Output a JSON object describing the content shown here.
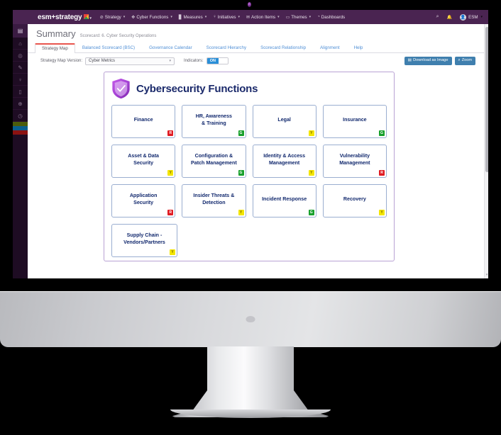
{
  "navbar": {
    "logo": "esm+strategy",
    "logo_caret": "▾",
    "items": [
      {
        "icon": "⊘",
        "label": "Strategy",
        "caret": "▾",
        "name": "strategy"
      },
      {
        "icon": "✥",
        "label": "Cyber Functions",
        "caret": "▾",
        "name": "cyber-functions"
      },
      {
        "icon": "▊",
        "label": "Measures",
        "caret": "▾",
        "name": "measures"
      },
      {
        "icon": "♀",
        "label": "Initiatives",
        "caret": "▾",
        "name": "initiatives"
      },
      {
        "icon": "✉",
        "label": "Action Items",
        "caret": "▾",
        "name": "action-items"
      },
      {
        "icon": "▭",
        "label": "Themes",
        "caret": "▾",
        "name": "themes"
      },
      {
        "icon": "◔",
        "label": "Dashboards",
        "caret": "",
        "name": "dashboards"
      }
    ],
    "search_icon": "⌕",
    "bell_icon": "🔔",
    "avatar_icon": "👤",
    "user": "ESM",
    "user_caret": "▾",
    "bg_color": "#4a2451"
  },
  "sidebar": {
    "top_icon": "▤",
    "icons": [
      "⌂",
      "◎",
      "✎",
      "♀",
      "▯",
      "⊕",
      "◷"
    ],
    "bars": [
      {
        "color": "#4c5c0b",
        "name": "bar-olive"
      },
      {
        "color": "#0a5f8f",
        "name": "bar-blue"
      },
      {
        "color": "#8c1212",
        "name": "bar-red"
      }
    ]
  },
  "page": {
    "title": "Summary",
    "breadcrumb": "Scorecard: 6. Cyber Security Operations"
  },
  "tabs": [
    {
      "label": "Strategy Map",
      "active": true
    },
    {
      "label": "Balanced Scorecard (BSC)",
      "active": false
    },
    {
      "label": "Governance Calendar",
      "active": false
    },
    {
      "label": "Scorecard Hierarchy",
      "active": false
    },
    {
      "label": "Scorecard Relationship",
      "active": false
    },
    {
      "label": "Alignment",
      "active": false
    },
    {
      "label": "Help",
      "active": false
    }
  ],
  "toolbar": {
    "version_label": "Strategy Map Version:",
    "version_value": "Cyber Metrics",
    "version_caret": "▾",
    "indicators_label": "Indicators:",
    "indicators_state": "ON",
    "download_icon": "▤",
    "download_label": "Download as Image",
    "zoom_icon": "⌕",
    "zoom_label": "Zoom"
  },
  "map": {
    "title": "Cybersecurity Functions",
    "icon": "shield-check-icon",
    "border_color": "#b9a2d4",
    "rows": [
      [
        {
          "label": "Finance",
          "status": "R"
        },
        {
          "label": "HR, Awareness\n& Training",
          "status": "G"
        },
        {
          "label": "Legal",
          "status": "Y"
        },
        {
          "label": "Insurance",
          "status": "G"
        }
      ],
      [
        {
          "label": "Asset & Data\nSecurity",
          "status": "Y"
        },
        {
          "label": "Configuration &\nPatch Management",
          "status": "G"
        },
        {
          "label": "Identity & Access\nManagement",
          "status": "Y"
        },
        {
          "label": "Vulnerability\nManagement",
          "status": "R"
        }
      ],
      [
        {
          "label": "Application\nSecurity",
          "status": "R"
        },
        {
          "label": "Insider Threats &\nDetection",
          "status": "Y"
        },
        {
          "label": "Incident Response",
          "status": "G"
        },
        {
          "label": "Recovery",
          "status": "Y"
        }
      ],
      [
        {
          "label": "Supply Chain -\nVendors/Partners",
          "status": "Y"
        }
      ]
    ],
    "status_colors": {
      "R": "#e01b22",
      "G": "#18a02c",
      "Y": "#f3e500"
    }
  },
  "scrollbar": {
    "arrow": "▾"
  }
}
